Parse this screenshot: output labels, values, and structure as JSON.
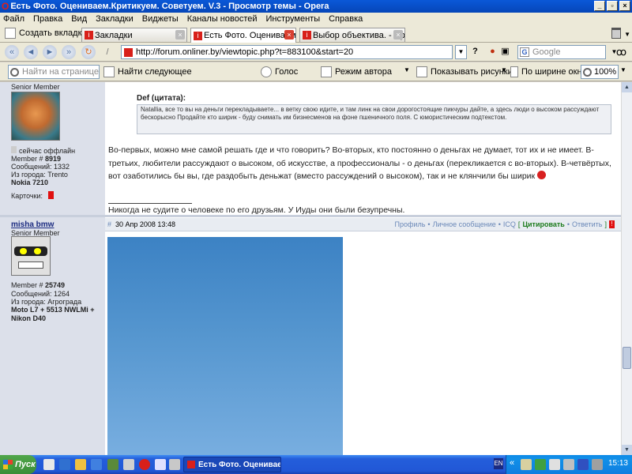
{
  "window": {
    "title": "Есть Фото. Оцениваем.Критикуем. Советуем. V.3 - Просмотр темы - Opera"
  },
  "menu": [
    "Файл",
    "Правка",
    "Вид",
    "Закладки",
    "Виджеты",
    "Каналы новостей",
    "Инструменты",
    "Справка"
  ],
  "tabs": {
    "new_tab_label": "Создать вкладку",
    "items": [
      {
        "label": "Закладки",
        "active": false
      },
      {
        "label": "Есть Фото. Оцениваем....",
        "active": true
      },
      {
        "label": "Выбор объектива. - Пр...",
        "active": false
      }
    ]
  },
  "address": {
    "url": "http://forum.onliner.by/viewtopic.php?t=883100&start=20",
    "search_engine": "Google",
    "help_label": "?"
  },
  "toolbar": {
    "find_placeholder": "Найти на странице",
    "find_next": "Найти следующее",
    "voice": "Голос",
    "author_mode": "Режим автора",
    "show_images": "Показывать рисунки",
    "fit_width": "По ширине окна",
    "zoom": "100%"
  },
  "post1": {
    "member_rank": "Senior Member",
    "status": "сейчас оффлайн",
    "member_no_label": "Member #",
    "member_no": "8919",
    "messages": "Сообщений: 1332",
    "city": "Из города: Trento",
    "gear": "Nokia 7210",
    "cards_label": "Карточки:",
    "quote_author": "Def (цитата):",
    "quote_text": "Natallia, все то вы на деньги перекладываете... в ветку свою идите, и там линк на свои дорогостоящие пикчуры дайте, а здесь люди о высоком рассуждают бескорысно Продайте кто ширик - буду снимать им бизнесменов на фоне пшеничного поля. С юмористическим подтекстом.",
    "body": "Во-первых, можно мне самой решать где и что говорить? Во-вторых, кто постоянно о деньгах не думает, тот их и не имеет. В-третьих, любители рассуждают о высоком, об искусстве, а профессионалы - о деньгах (перекликается с во-вторых). В-четвёртых, вот озаботились бы вы, где раздобыть деньжат (вместо рассуждений о высоком), так и не клянчили бы ширик",
    "signature": "Никогда не судите о человеке по его друзьям. У Иуды они были безупречны."
  },
  "post2": {
    "username": "misha bmw",
    "member_rank": "Senior Member",
    "member_no_label": "Member #",
    "member_no": "25749",
    "messages": "Сообщений: 1264",
    "city": "Из города: Агрограда",
    "gear": "Moto L7 + 5513 NWLMi + Nikon D40",
    "anchor": "#",
    "date": "30 Апр 2008 13:48",
    "links": {
      "profile": "Профиль",
      "pm": "Личное сообщение",
      "icq": "ICQ",
      "quote": "Цитировать",
      "reply": "Ответить",
      "report": "!"
    }
  },
  "taskbar": {
    "start": "Пуск",
    "task": "Есть Фото. Оценивае...",
    "lang": "EN",
    "clock": "15:13"
  },
  "colors": {
    "title_bar": "#0646b8",
    "opera_red": "#d8201a",
    "forum_side": "#dce0ea",
    "quote_green": "#1a7a1a"
  }
}
